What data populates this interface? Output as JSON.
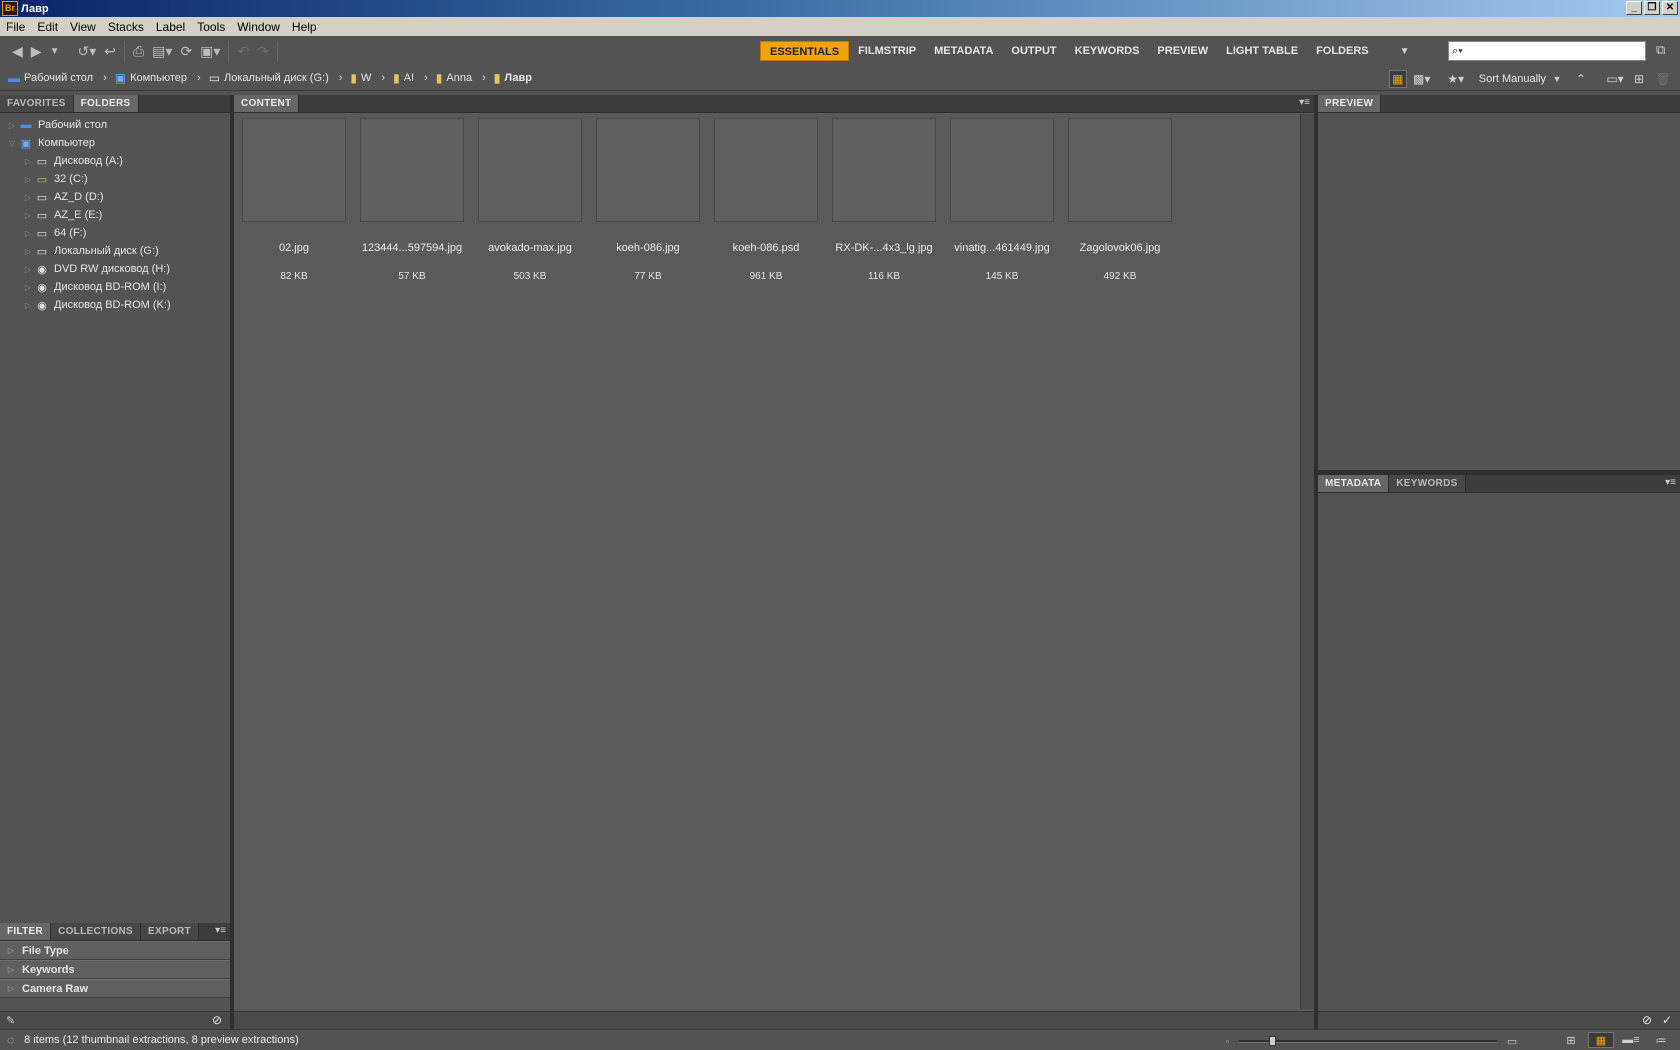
{
  "window": {
    "title": "Лавр",
    "logo": "Br",
    "buttons": [
      "_",
      "❐",
      "✕"
    ]
  },
  "menu": [
    "File",
    "Edit",
    "View",
    "Stacks",
    "Label",
    "Tools",
    "Window",
    "Help"
  ],
  "workspaces": {
    "items": [
      "ESSENTIALS",
      "FILMSTRIP",
      "METADATA",
      "OUTPUT",
      "KEYWORDS",
      "PREVIEW",
      "LIGHT TABLE",
      "FOLDERS"
    ],
    "active": "ESSENTIALS"
  },
  "search": {
    "value": "",
    "placeholder": ""
  },
  "path": [
    "Рабочий стол",
    "Компьютер",
    "Локальный диск (G:)",
    "W",
    "AI",
    "Anna",
    "Лавр"
  ],
  "sort": {
    "label": "Sort Manually"
  },
  "left_panel": {
    "tabs": [
      "FAVORITES",
      "FOLDERS"
    ],
    "active_tab": "FOLDERS",
    "tree": [
      {
        "label": "Рабочий стол",
        "icon": "desktop-icon",
        "level": 0,
        "expanded": false
      },
      {
        "label": "Компьютер",
        "icon": "computer-icon",
        "level": 0,
        "expanded": true
      },
      {
        "label": "Дисковод (A:)",
        "icon": "floppy-drive-icon",
        "level": 1,
        "expanded": false
      },
      {
        "label": "32 (C:)",
        "icon": "system-drive-icon",
        "level": 1,
        "expanded": false
      },
      {
        "label": "AZ_D (D:)",
        "icon": "hard-drive-icon",
        "level": 1,
        "expanded": false
      },
      {
        "label": "AZ_E (E:)",
        "icon": "hard-drive-icon",
        "level": 1,
        "expanded": false
      },
      {
        "label": "64 (F:)",
        "icon": "hard-drive-icon",
        "level": 1,
        "expanded": false
      },
      {
        "label": "Локальный диск (G:)",
        "icon": "hard-drive-icon",
        "level": 1,
        "expanded": false
      },
      {
        "label": "DVD RW дисковод (H:)",
        "icon": "dvd-drive-icon",
        "level": 1,
        "expanded": false
      },
      {
        "label": "Дисковод BD-ROM (I:)",
        "icon": "bd-drive-icon",
        "level": 1,
        "expanded": false
      },
      {
        "label": "Дисковод BD-ROM (K:)",
        "icon": "bd-drive-icon",
        "level": 1,
        "expanded": false
      }
    ]
  },
  "filter_panel": {
    "tabs": [
      "FILTER",
      "COLLECTIONS",
      "EXPORT"
    ],
    "active_tab": "FILTER",
    "sections": [
      "File Type",
      "Keywords",
      "Camera Raw"
    ]
  },
  "content_panel": {
    "tab": "CONTENT",
    "items": [
      {
        "name": "02.jpg",
        "size": "82 KB"
      },
      {
        "name": "123444...597594.jpg",
        "size": "57 KB"
      },
      {
        "name": "avokado-max.jpg",
        "size": "503 KB"
      },
      {
        "name": "koeh-086.jpg",
        "size": "77 KB"
      },
      {
        "name": "koeh-086.psd",
        "size": "961 KB"
      },
      {
        "name": "RX-DK-...4x3_lg.jpg",
        "size": "116 KB"
      },
      {
        "name": "vinatig...461449.jpg",
        "size": "145 KB"
      },
      {
        "name": "Zagolovok06.jpg",
        "size": "492 KB"
      }
    ]
  },
  "preview_panel": {
    "tab": "PREVIEW"
  },
  "metadata_panel": {
    "tabs": [
      "METADATA",
      "KEYWORDS"
    ],
    "active_tab": "METADATA"
  },
  "status": {
    "text": "8 items (12 thumbnail extractions, 8 preview extractions)",
    "thumbnail_zoom_fraction": 0.12
  },
  "colors": {
    "accent": "#f0a30a",
    "panel_bg": "#535353",
    "content_bg": "#5a5a5a",
    "tab_bar": "#3d3d3d"
  }
}
